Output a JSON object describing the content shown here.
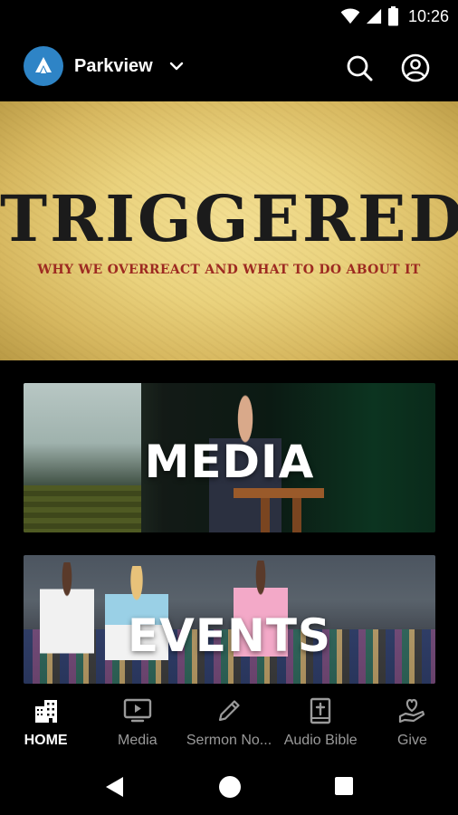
{
  "status_bar": {
    "time": "10:26"
  },
  "app_bar": {
    "org_name": "Parkview",
    "logo_icon": "parkview-logo-icon",
    "accent_color": "#2e84c6"
  },
  "hero": {
    "title": "TRIGGERED",
    "subtitle": "WHY WE OVERREACT AND WHAT TO DO ABOUT IT",
    "subtitle_color": "#9d2a21"
  },
  "cards": [
    {
      "label": "MEDIA"
    },
    {
      "label": "EVENTS"
    }
  ],
  "bottom_nav": {
    "items": [
      {
        "label": "HOME",
        "icon": "home-building-icon",
        "active": true
      },
      {
        "label": "Media",
        "icon": "tv-play-icon",
        "active": false
      },
      {
        "label": "Sermon No...",
        "icon": "pencil-icon",
        "active": false
      },
      {
        "label": "Audio Bible",
        "icon": "bible-icon",
        "active": false
      },
      {
        "label": "Give",
        "icon": "hand-heart-icon",
        "active": false
      }
    ]
  }
}
